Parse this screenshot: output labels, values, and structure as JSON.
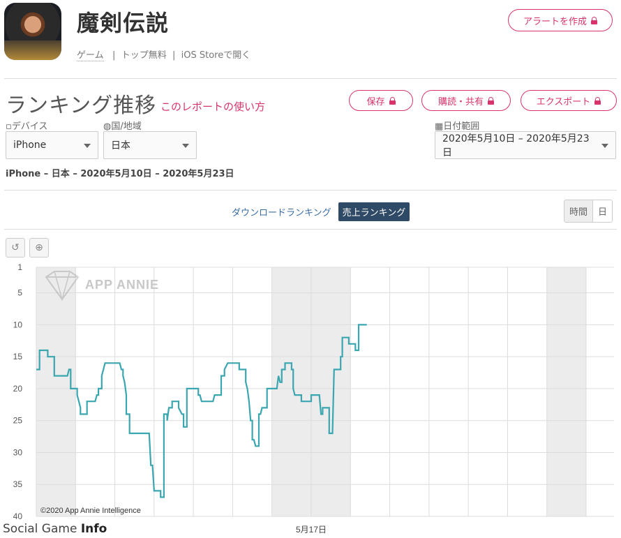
{
  "app": {
    "title": "魔剣伝説",
    "category": "ゲーム",
    "rank_label": "トップ無料",
    "store": "iOS Storeで開く",
    "alert_button": "アラートを作成"
  },
  "report": {
    "title": "ランキング推移",
    "howto_link": "このレポートの使い方",
    "save_button": "保存",
    "share_button": "購読・共有",
    "export_button": "エクスポート"
  },
  "filters": {
    "device_label": "デバイス",
    "device_value": "iPhone",
    "country_label": "国/地域",
    "country_value": "日本",
    "date_label": "日付範囲",
    "date_value": "2020年5月10日 – 2020年5月23日"
  },
  "summary": "iPhone – 日本 – 2020年5月10日 – 2020年5月23日",
  "tabs": {
    "download": "ダウンロードランキング",
    "revenue": "売上ランキング"
  },
  "granularity": {
    "hour": "時間",
    "day": "日"
  },
  "watermark": {
    "brand": "APP ANNIE",
    "copyright": "©2020 App Annie Intelligence",
    "site_prefix": "Social Game ",
    "site_suffix": "Info"
  },
  "colors": {
    "accent": "#d8336a",
    "line": "#3aa6b0",
    "tab_active": "#2f4a66"
  },
  "chart_data": {
    "type": "line",
    "yticks": [
      1,
      5,
      10,
      15,
      20,
      25,
      30,
      35,
      40
    ],
    "ylim": [
      1,
      40
    ],
    "y_reversed": true,
    "xlim": [
      0,
      336
    ],
    "xtick_labels": [
      {
        "x": 168,
        "label": "5月17日"
      }
    ],
    "series": [
      {
        "values": [
          [
            0,
            17
          ],
          [
            2,
            17
          ],
          [
            2,
            14
          ],
          [
            7,
            14
          ],
          [
            7,
            15
          ],
          [
            11,
            15
          ],
          [
            11,
            18
          ],
          [
            19,
            18
          ],
          [
            20,
            17
          ],
          [
            21,
            17
          ],
          [
            21,
            20
          ],
          [
            25,
            20
          ],
          [
            25,
            21
          ],
          [
            26,
            22
          ],
          [
            27,
            23
          ],
          [
            27,
            24
          ],
          [
            31,
            24
          ],
          [
            31,
            22
          ],
          [
            36,
            22
          ],
          [
            37,
            21
          ],
          [
            38,
            21
          ],
          [
            38,
            20
          ],
          [
            40,
            20
          ],
          [
            40,
            18
          ],
          [
            41,
            17
          ],
          [
            42,
            16
          ],
          [
            51,
            16
          ],
          [
            52,
            17
          ],
          [
            53,
            17
          ],
          [
            53,
            18
          ],
          [
            54,
            19
          ],
          [
            55,
            21
          ],
          [
            55,
            24
          ],
          [
            57,
            24
          ],
          [
            57,
            27
          ],
          [
            69,
            27
          ],
          [
            70,
            32
          ],
          [
            71,
            32
          ],
          [
            72,
            36
          ],
          [
            76,
            36
          ],
          [
            76,
            37
          ],
          [
            78,
            37
          ],
          [
            78,
            24
          ],
          [
            80,
            24
          ],
          [
            80,
            25
          ],
          [
            81,
            23
          ],
          [
            83,
            23
          ],
          [
            83,
            22
          ],
          [
            87,
            22
          ],
          [
            87,
            23
          ],
          [
            89,
            24
          ],
          [
            90,
            24
          ],
          [
            90,
            26
          ],
          [
            92,
            26
          ],
          [
            92,
            20
          ],
          [
            99,
            20
          ],
          [
            99,
            21
          ],
          [
            100,
            21
          ],
          [
            101,
            22
          ],
          [
            108,
            22
          ],
          [
            109,
            21
          ],
          [
            113,
            21
          ],
          [
            113,
            18
          ],
          [
            115,
            18
          ],
          [
            115,
            17
          ],
          [
            117,
            16
          ],
          [
            124,
            16
          ],
          [
            124,
            17
          ],
          [
            128,
            17
          ],
          [
            128,
            19
          ],
          [
            129,
            20
          ],
          [
            130,
            22
          ],
          [
            131,
            25
          ],
          [
            132,
            25
          ],
          [
            132,
            28
          ],
          [
            133,
            28
          ],
          [
            134,
            29
          ],
          [
            136,
            29
          ],
          [
            136,
            24
          ],
          [
            137,
            24
          ],
          [
            138,
            23
          ],
          [
            141,
            23
          ],
          [
            141,
            20
          ],
          [
            147,
            20
          ],
          [
            148,
            18
          ],
          [
            149,
            19
          ],
          [
            150,
            19
          ],
          [
            150,
            17
          ],
          [
            152,
            17
          ],
          [
            152,
            16
          ],
          [
            156,
            16
          ],
          [
            156,
            17
          ],
          [
            157,
            17
          ],
          [
            157,
            20
          ],
          [
            158,
            21
          ],
          [
            162,
            21
          ],
          [
            162,
            22
          ],
          [
            168,
            22
          ],
          [
            168,
            21
          ],
          [
            173,
            21
          ],
          [
            174,
            24
          ],
          [
            175,
            24
          ],
          [
            175,
            23
          ],
          [
            179,
            23
          ],
          [
            179,
            27
          ],
          [
            181,
            27
          ],
          [
            182,
            17
          ],
          [
            186,
            17
          ],
          [
            186,
            15
          ],
          [
            187,
            15
          ],
          [
            187,
            12
          ],
          [
            191,
            12
          ],
          [
            191,
            13
          ],
          [
            195,
            13
          ],
          [
            195,
            14
          ],
          [
            197,
            14
          ],
          [
            197,
            10
          ],
          [
            202,
            10
          ]
        ]
      }
    ]
  }
}
